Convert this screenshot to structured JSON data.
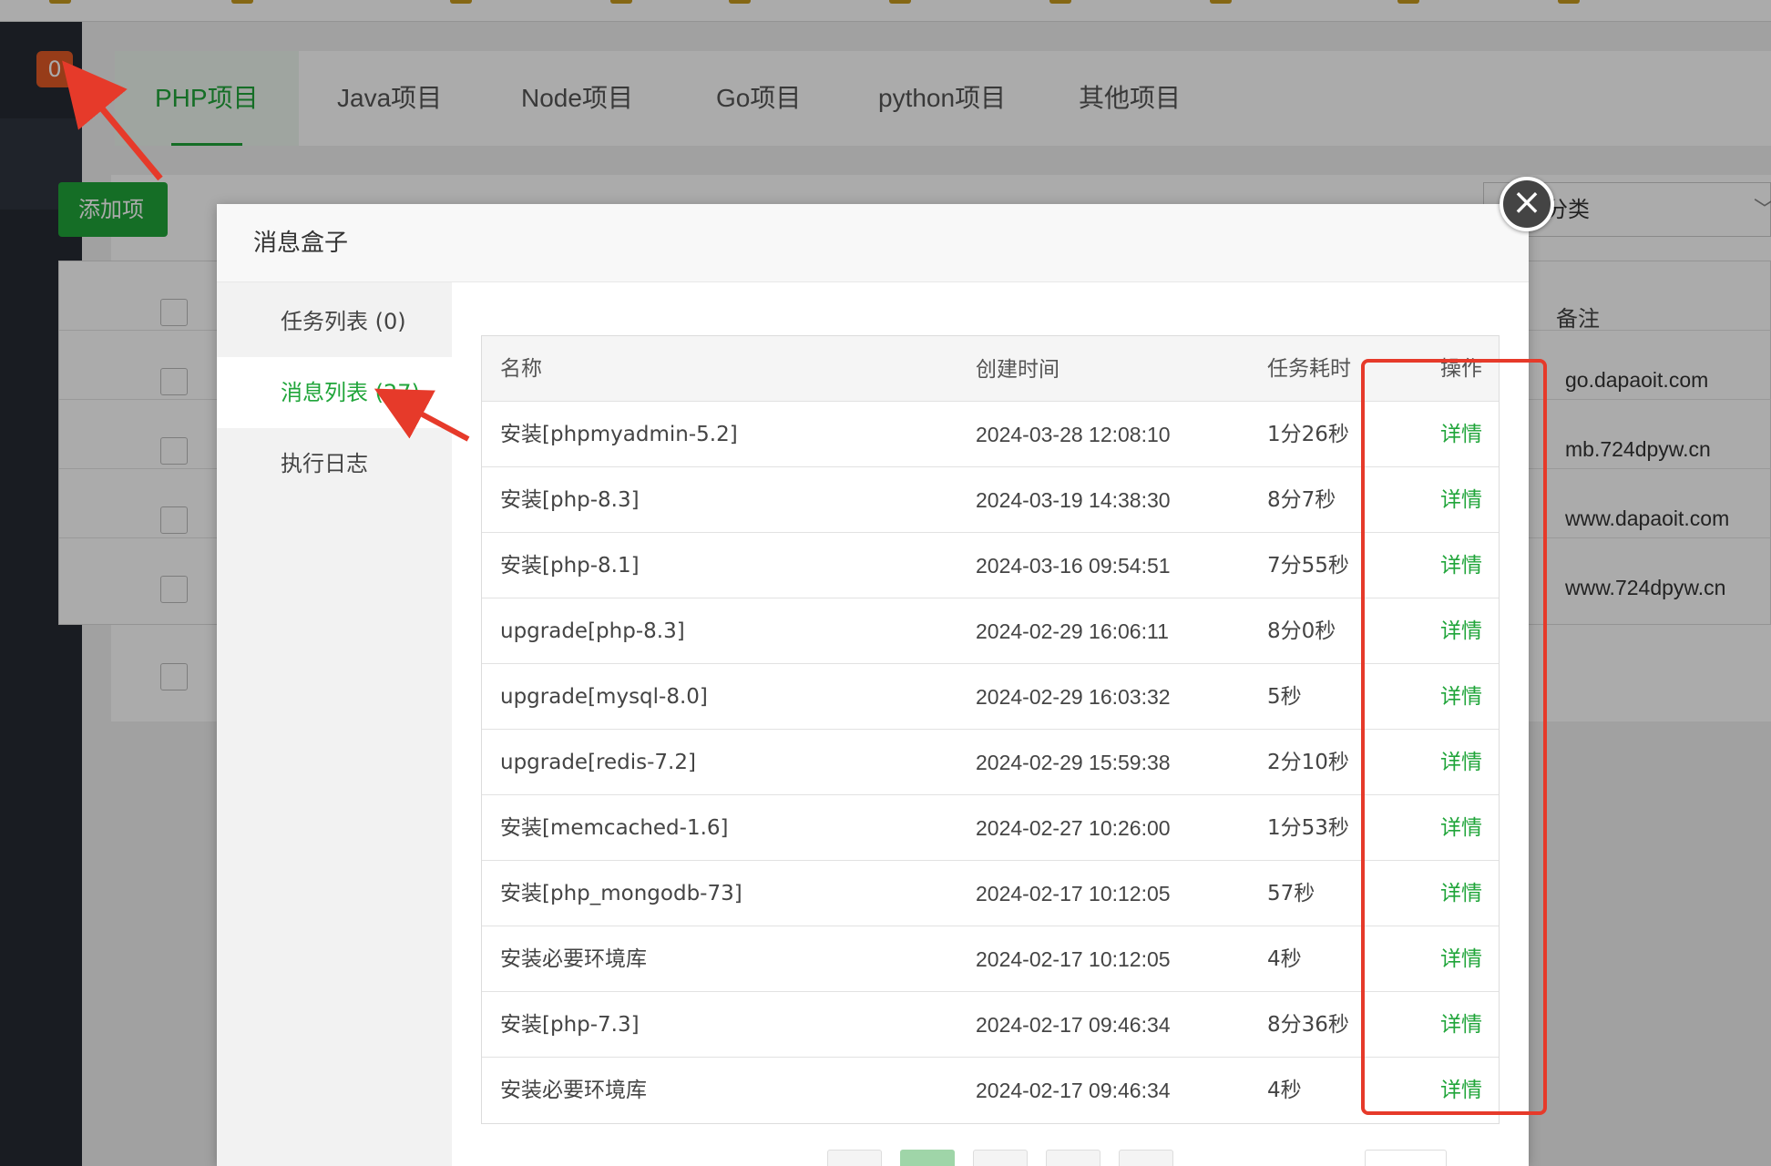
{
  "sidebar": {
    "badge_count": "0"
  },
  "tabs": [
    "PHP项目",
    "Java项目",
    "Node项目",
    "Go项目",
    "python项目",
    "其他项目"
  ],
  "toolbar": {
    "add_label": "添加项",
    "category_label": "全部分类",
    "category_chevron": "﹀"
  },
  "bg_table": {
    "note_header": "备注",
    "domains": [
      "go.dapaoit.com",
      "mb.724dpyw.cn",
      "www.dapaoit.com",
      "www.724dpyw.cn"
    ]
  },
  "modal": {
    "title": "消息盒子",
    "close_icon": "×",
    "nav": [
      "任务列表 (0)",
      "消息列表 (27)",
      "执行日志"
    ],
    "table": {
      "headers": [
        "名称",
        "创建时间",
        "任务耗时",
        "操作"
      ],
      "rows": [
        {
          "name": "安装[phpmyadmin-5.2]",
          "time": "2024-03-28 12:08:10",
          "duration": "1分26秒",
          "action": "详情"
        },
        {
          "name": "安装[php-8.3]",
          "time": "2024-03-19 14:38:30",
          "duration": "8分7秒",
          "action": "详情"
        },
        {
          "name": "安装[php-8.1]",
          "time": "2024-03-16 09:54:51",
          "duration": "7分55秒",
          "action": "详情"
        },
        {
          "name": "upgrade[php-8.3]",
          "time": "2024-02-29 16:06:11",
          "duration": "8分0秒",
          "action": "详情"
        },
        {
          "name": "upgrade[mysql-8.0]",
          "time": "2024-02-29 16:03:32",
          "duration": "5秒",
          "action": "详情"
        },
        {
          "name": "upgrade[redis-7.2]",
          "time": "2024-02-29 15:59:38",
          "duration": "2分10秒",
          "action": "详情"
        },
        {
          "name": "安装[memcached-1.6]",
          "time": "2024-02-27 10:26:00",
          "duration": "1分53秒",
          "action": "详情"
        },
        {
          "name": "安装[php_mongodb-73]",
          "time": "2024-02-17 10:12:05",
          "duration": "57秒",
          "action": "详情"
        },
        {
          "name": "安装必要环境库",
          "time": "2024-02-17 10:12:05",
          "duration": "4秒",
          "action": "详情"
        },
        {
          "name": "安装[php-7.3]",
          "time": "2024-02-17 09:46:34",
          "duration": "8分36秒",
          "action": "详情"
        },
        {
          "name": "安装必要环境库",
          "time": "2024-02-17 09:46:34",
          "duration": "4秒",
          "action": "详情"
        }
      ]
    }
  },
  "colors": {
    "accent": "#20a53a",
    "badge": "#e25a26",
    "annotation": "#e63a2a"
  }
}
